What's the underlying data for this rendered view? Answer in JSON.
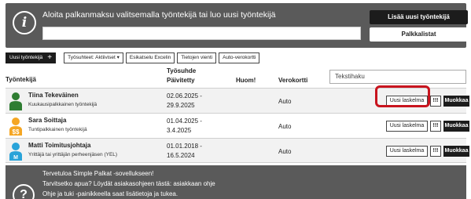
{
  "top": {
    "title": "Aloita palkanmaksu valitsemalla työntekijä tai luo uusi työntekijä",
    "add_button": "Lisää uusi työntekijä",
    "payslips_button": "Palkkalistat",
    "info_glyph": "i",
    "input_value": ""
  },
  "toolbar": {
    "new_employee": "Uusi työntekijä",
    "plus": "+",
    "employment_filter": "Työsuhteet: Aktiiviset ▾",
    "excel_preview": "Esikatselu Excelin",
    "data_export": "Tietojen vienti",
    "auto_tax_card": "Auto-verokortti"
  },
  "table": {
    "headers": {
      "employee": "Työntekijä",
      "employment_line1": "Työsuhde",
      "employment_line2": "Päivitetty",
      "note": "Huom!",
      "tax_card": "Verokortti"
    },
    "search_placeholder": "Tekstihaku",
    "rows": [
      {
        "name": "Tiina Tekeväinen",
        "type": "Kuukausipalkkainen työntekijä",
        "start": "02.06.2025 -",
        "end": "29.9.2025",
        "tax_card": "Auto",
        "calc_label": "Uusi laskelma",
        "excl_label": "!!!",
        "edit_label": "Muokkaa",
        "avatar_color": "#2e7d32"
      },
      {
        "name": "Sara Soittaja",
        "type": "Tuntipalkkainen työntekijä",
        "start": "01.04.2025 -",
        "end": "3.4.2025",
        "tax_card": "Auto",
        "calc_label": "Uusi laskelma",
        "excl_label": "!!!",
        "edit_label": "Muokkaa",
        "avatar_color": "#f5a623"
      },
      {
        "name": "Matti Toimitusjohtaja",
        "type": "Yrittäjä tai yrittäjän perheenjäsen (YEL)",
        "start": "01.01.2018 -",
        "end": "16.5.2024",
        "tax_card": "Auto",
        "calc_label": "Uusi laskelma",
        "excl_label": "!!!",
        "edit_label": "Muokkaa",
        "avatar_color": "#29a3d9"
      }
    ]
  },
  "bottom": {
    "line1": "Tervetuloa Simple Palkat -sovellukseen!",
    "line2": "Tarvitsetko apua? Löydät asiakasohjeen tästä: asiakkaan ohje",
    "line3": "Ohje ja tuki -painikkeella saat lisätietoja ja tukea.",
    "help_glyph": "?"
  },
  "colors": {
    "panel": "#5a5a5a",
    "dark_button": "#1c1c1c",
    "highlight": "#c8141e"
  }
}
